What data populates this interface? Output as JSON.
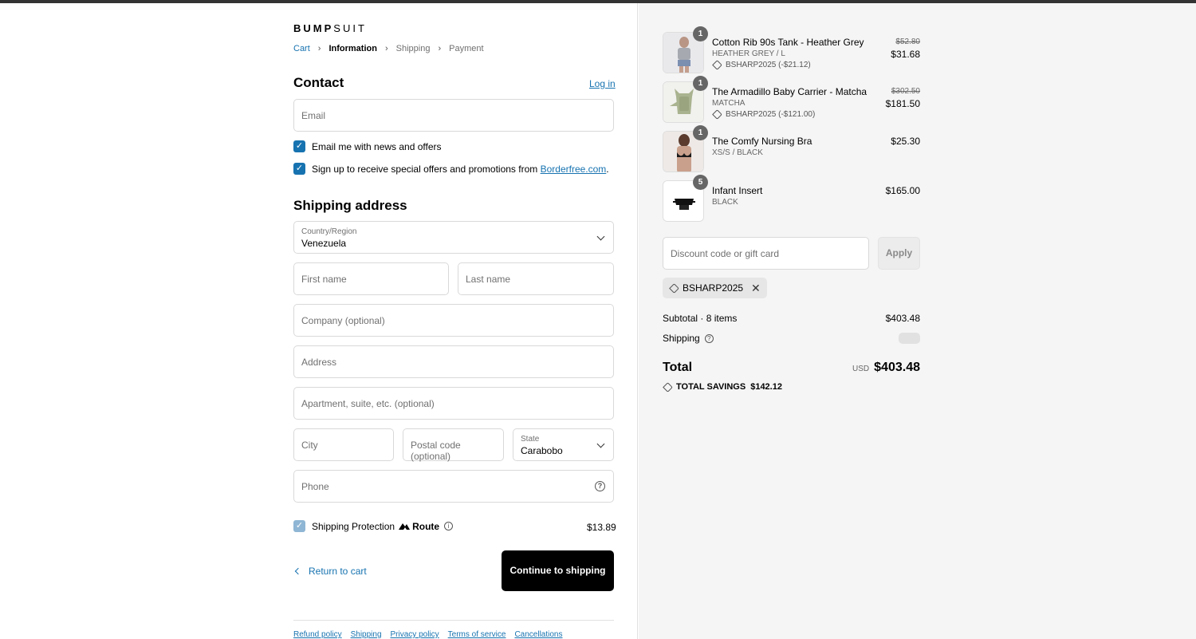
{
  "brand": {
    "bold": "BUMP",
    "light": "SUIT"
  },
  "breadcrumb": [
    "Cart",
    "Information",
    "Shipping",
    "Payment"
  ],
  "contact": {
    "heading": "Contact",
    "login": "Log in",
    "email_placeholder": "Email",
    "news_label": "Email me with news and offers",
    "borderfree_label": "Sign up to receive special offers and promotions from ",
    "borderfree_link": "Borderfree.com",
    "borderfree_end": "."
  },
  "shipping": {
    "heading": "Shipping address",
    "country_label": "Country/Region",
    "country_value": "Venezuela",
    "first_name": "First name",
    "last_name": "Last name",
    "company": "Company (optional)",
    "address": "Address",
    "apartment": "Apartment, suite, etc. (optional)",
    "city": "City",
    "postal": "Postal code (optional)",
    "state_label": "State",
    "state_value": "Carabobo",
    "phone": "Phone",
    "help_glyph": "?"
  },
  "protection": {
    "label": "Shipping Protection",
    "brand": "Route",
    "info_glyph": "i",
    "price": "$13.89"
  },
  "actions": {
    "return": "Return to cart",
    "continue": "Continue to shipping"
  },
  "footer_links": [
    "Refund policy",
    "Shipping",
    "Privacy policy",
    "Terms of service",
    "Cancellations"
  ],
  "items": [
    {
      "name": "Cotton Rib 90s Tank - Heather Grey",
      "variant": "HEATHER GREY / L",
      "discount": "BSHARP2025 (-$21.12)",
      "old_price": "$52.80",
      "price": "$31.68",
      "qty": "1",
      "icon": "tank-top-photo"
    },
    {
      "name": "The Armadillo Baby Carrier - Matcha",
      "variant": "MATCHA",
      "discount": "BSHARP2025 (-$121.00)",
      "old_price": "$302.50",
      "price": "$181.50",
      "qty": "1",
      "icon": "baby-carrier-photo"
    },
    {
      "name": "The Comfy Nursing Bra",
      "variant": "XS/S / BLACK",
      "price": "$25.30",
      "qty": "1",
      "icon": "nursing-bra-photo"
    },
    {
      "name": "Infant Insert",
      "variant": "BLACK",
      "price": "$165.00",
      "qty": "5",
      "icon": "infant-insert-photo"
    }
  ],
  "discount": {
    "placeholder": "Discount code or gift card",
    "apply": "Apply",
    "code": "BSHARP2025",
    "remove_glyph": "✕"
  },
  "summary": {
    "subtotal_label": "Subtotal · 8 items",
    "subtotal_value": "$403.48",
    "shipping_label": "Shipping",
    "total_label": "Total",
    "currency": "USD",
    "total_value": "$403.48",
    "savings_label": "TOTAL SAVINGS",
    "savings_value": "$142.12"
  },
  "colors": {
    "link": "#1773b0",
    "button": "#000000",
    "sidebar_bg": "#f5f5f5"
  }
}
